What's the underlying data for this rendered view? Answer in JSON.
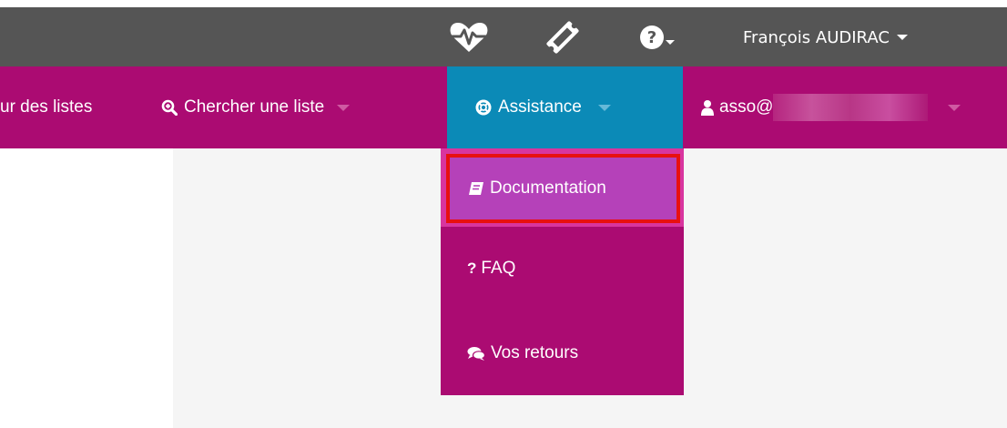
{
  "topbar": {
    "icons": [
      "heartbeat-icon",
      "ticket-icon",
      "help-icon"
    ],
    "user_name": "François AUDIRAC"
  },
  "navbar": {
    "items": [
      {
        "label": "ur des listes"
      },
      {
        "label": "Chercher une liste",
        "icon": "search-plus-icon"
      },
      {
        "label": "Assistance",
        "icon": "life-ring-icon",
        "active": true
      },
      {
        "label": "asso@",
        "icon": "user-icon"
      }
    ]
  },
  "dropdown": {
    "items": [
      {
        "label": "Documentation",
        "icon": "book-icon",
        "highlighted": true
      },
      {
        "label": "FAQ",
        "icon": "question-icon"
      },
      {
        "label": "Vos retours",
        "icon": "comments-icon"
      }
    ]
  },
  "colors": {
    "topbar": "#555555",
    "navbar": "#ab0b72",
    "active_tab": "#0b8ab7",
    "highlight_item": "#b541b9",
    "highlight_border": "#e81010"
  }
}
